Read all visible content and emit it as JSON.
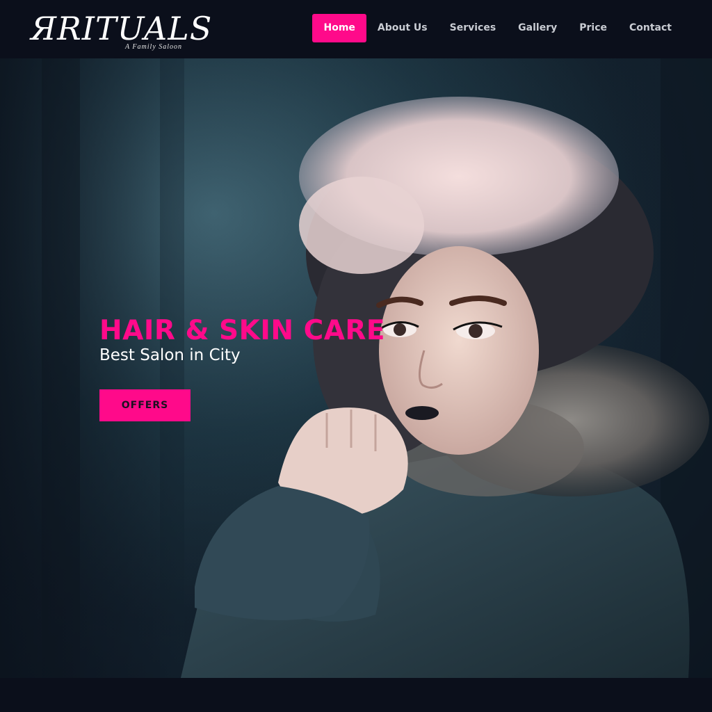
{
  "brand": {
    "name": "Rituals",
    "tagline": "A Family Saloon"
  },
  "nav": {
    "items": [
      {
        "label": "Home",
        "active": true
      },
      {
        "label": "About Us",
        "active": false
      },
      {
        "label": "Services",
        "active": false
      },
      {
        "label": "Gallery",
        "active": false
      },
      {
        "label": "Price",
        "active": false
      },
      {
        "label": "Contact",
        "active": false
      }
    ]
  },
  "hero": {
    "title": "HAIR & SKIN CARE",
    "subtitle": "Best Salon in City",
    "cta_label": "OFFERS"
  },
  "colors": {
    "accent": "#ff0a8a",
    "header_bg": "#0b0f1b",
    "nav_text": "#c9ccd3"
  }
}
